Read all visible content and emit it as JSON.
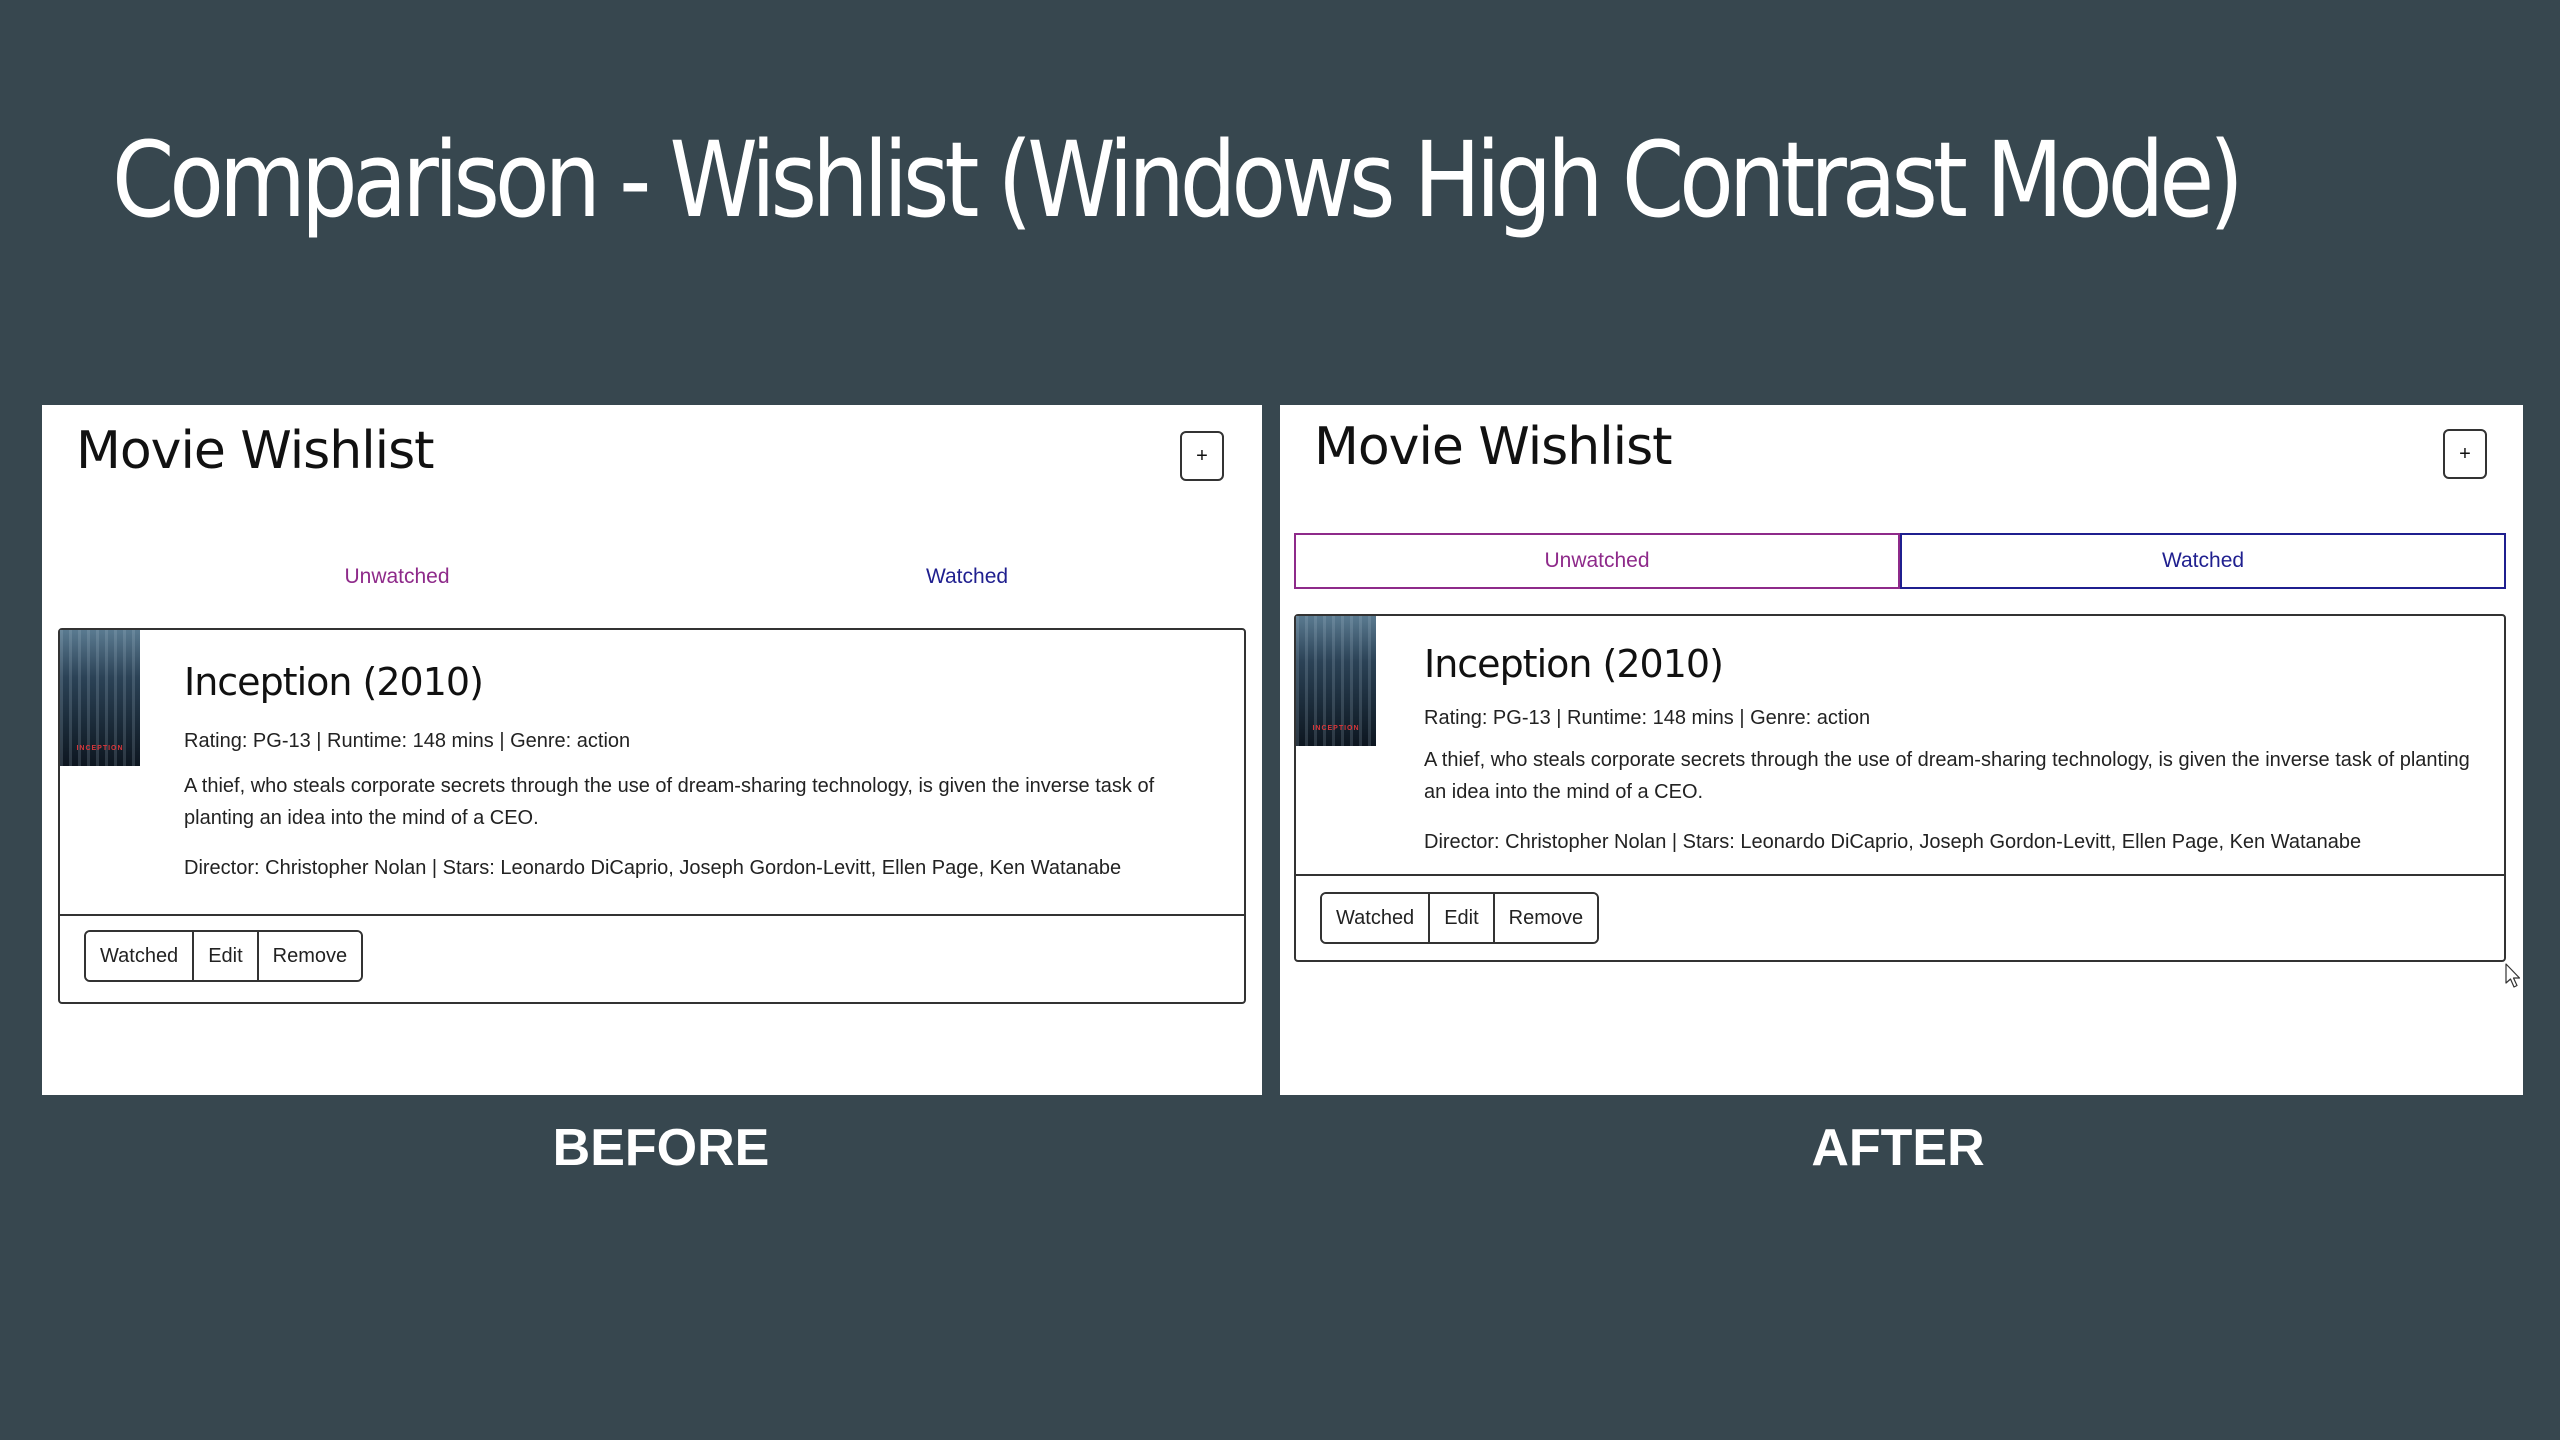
{
  "slide": {
    "title": "Comparison - Wishlist (Windows High Contrast Mode)",
    "captions": {
      "before": "BEFORE",
      "after": "AFTER"
    },
    "background_color": "#37474f"
  },
  "app": {
    "title": "Movie Wishlist",
    "add_button_label": "+",
    "tabs": [
      {
        "label": "Unwatched",
        "color": "#8e2a8a"
      },
      {
        "label": "Watched",
        "color": "#1f1f8f"
      }
    ],
    "movie": {
      "title": "Inception (2010)",
      "meta": "Rating: PG-13 | Runtime: 148 mins | Genre: action",
      "description": "A thief, who steals corporate secrets through the use of dream-sharing technology, is given the inverse task of planting an idea into the mind of a CEO.",
      "credits": "Director: Christopher Nolan | Stars: Leonardo DiCaprio, Joseph Gordon-Levitt, Ellen Page, Ken Watanabe",
      "poster_label": "INCEPTION",
      "actions": [
        "Watched",
        "Edit",
        "Remove"
      ]
    }
  }
}
